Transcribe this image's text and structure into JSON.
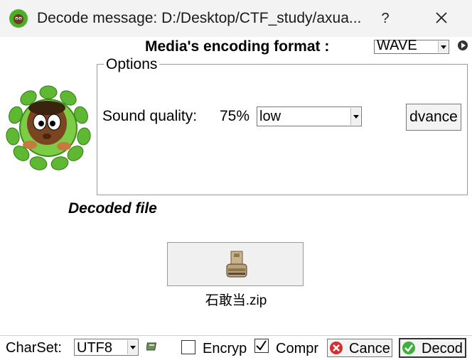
{
  "window": {
    "title": "Decode message: D:/Desktop/CTF_study/axua...",
    "help_label": "?",
    "close_icon": "close-icon",
    "app_icon": "jungle-kid-icon"
  },
  "media": {
    "encoding_label": "Media's encoding format :",
    "encoding_value": "WAVE",
    "play_icon": "play-icon"
  },
  "options": {
    "legend": "Options",
    "sound_quality_label": "Sound quality:",
    "sound_quality_value": "75%",
    "quality_select_value": "low",
    "advance_button_label": "dvance"
  },
  "decoded": {
    "label": "Decoded file",
    "file_name": "石敢当.zip",
    "file_icon": "archive-box-icon"
  },
  "bottom": {
    "charset_label": "CharSet:",
    "charset_value": "UTF8",
    "charset_icon": "book-icon",
    "encrypt_label": "Encryp",
    "encrypt_checked": false,
    "compress_label": "Compr",
    "compress_checked": true,
    "cancel_label": "Cance",
    "decode_label": "Decod",
    "cancel_color": "#d32f2f",
    "decode_color": "#3fae3a"
  }
}
